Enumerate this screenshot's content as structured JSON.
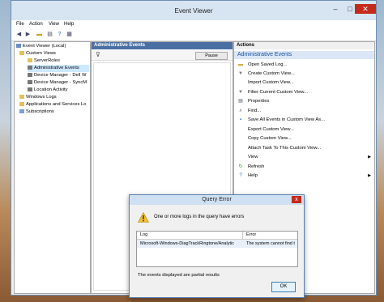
{
  "window": {
    "title": "Event Viewer",
    "minimize": "–",
    "maximize": "□",
    "close": "✕"
  },
  "menu": [
    "File",
    "Action",
    "View",
    "Help"
  ],
  "tree": {
    "root": "Event Viewer (Local)",
    "custom_views": "Custom Views",
    "server_roles": "ServerRoles",
    "admin_events": "Administrative Events",
    "device_dell": "Device Manager - Dell W",
    "device_sync": "Device Manager - SyncM",
    "location": "Location Activity",
    "windows_logs": "Windows Logs",
    "app_services": "Applications and Services Lo",
    "subscriptions": "Subscriptions"
  },
  "middle": {
    "header": "Administrative Events",
    "pause": "Pause"
  },
  "actions": {
    "header": "Actions",
    "section": "Administrative Events",
    "items": [
      "Open Saved Log...",
      "Create Custom View...",
      "Import Custom View...",
      "Filter Current Custom View...",
      "Properties",
      "Find...",
      "Save All Events in Custom View As...",
      "Export Custom View...",
      "Copy Custom View...",
      "Attach Task To This Custom View...",
      "View",
      "Refresh",
      "Help"
    ]
  },
  "dialog": {
    "title": "Query Error",
    "close": "x",
    "message": "One or more logs in the query have errors",
    "col_log": "Log",
    "col_error": "Error",
    "row_log": "Microsoft-Windows-DiagTrackRingtone/Analytic",
    "row_error": "The system cannot find t",
    "partial": "The events displayed are partial results",
    "ok": "OK"
  },
  "colors": {
    "accent": "#4a6fa3",
    "close_red": "#c42b1c",
    "section_blue": "#1a4fa0"
  }
}
